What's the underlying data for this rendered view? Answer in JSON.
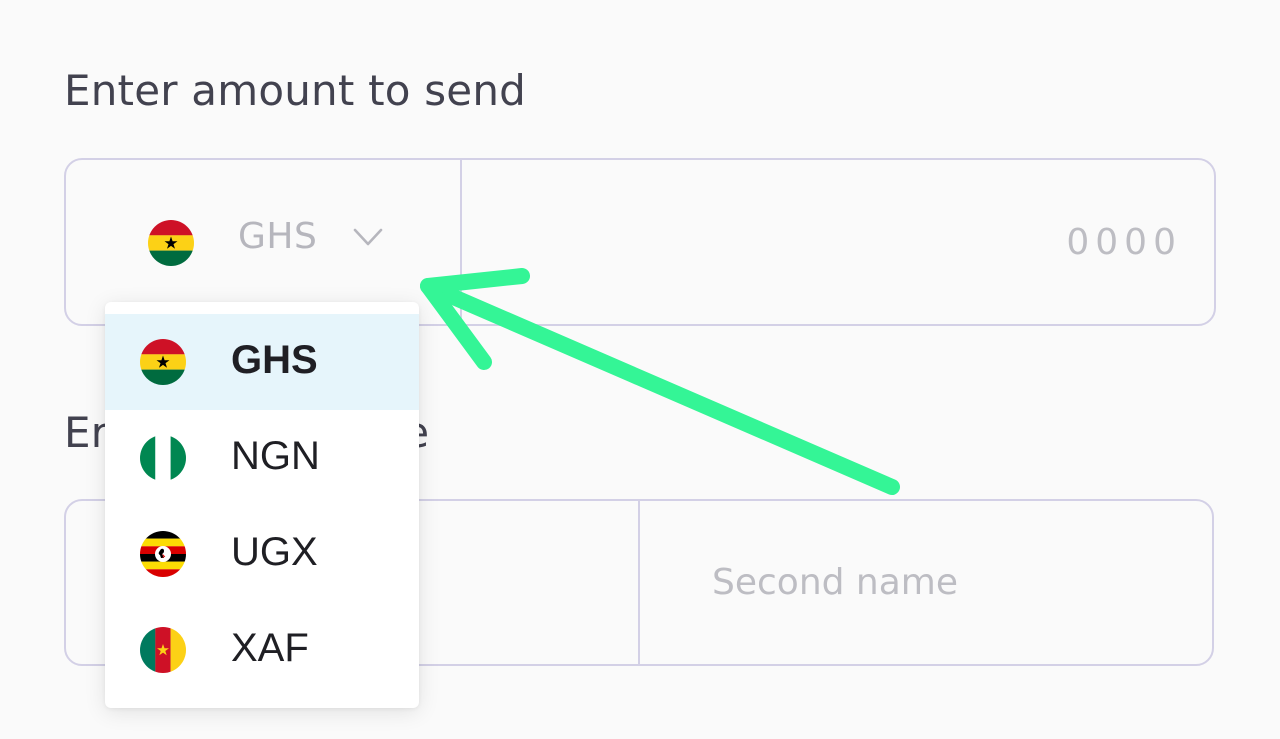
{
  "amount_section": {
    "label": "Enter amount to send",
    "currency": {
      "selected_code": "GHS",
      "flag_icon": "ghana-flag-icon",
      "chevron_icon": "chevron-down-icon"
    },
    "amount_placeholder": "0000"
  },
  "name_section": {
    "label_visible": "Er",
    "label_visible_tail": "e",
    "second_name_placeholder": "Second name"
  },
  "dropdown": {
    "options": [
      {
        "code": "GHS",
        "flag_icon": "ghana-flag-icon",
        "selected": true
      },
      {
        "code": "NGN",
        "flag_icon": "nigeria-flag-icon",
        "selected": false
      },
      {
        "code": "UGX",
        "flag_icon": "uganda-flag-icon",
        "selected": false
      },
      {
        "code": "XAF",
        "flag_icon": "cameroon-flag-icon",
        "selected": false
      }
    ]
  },
  "colors": {
    "field_border": "#d3d0e6",
    "label_text": "#42424f",
    "placeholder_text": "#bdbdc3",
    "selected_row": "#e6f5fb",
    "arrow_annotation": "#34f596"
  },
  "annotation": {
    "type": "arrow",
    "icon": "arrow-annotation"
  }
}
